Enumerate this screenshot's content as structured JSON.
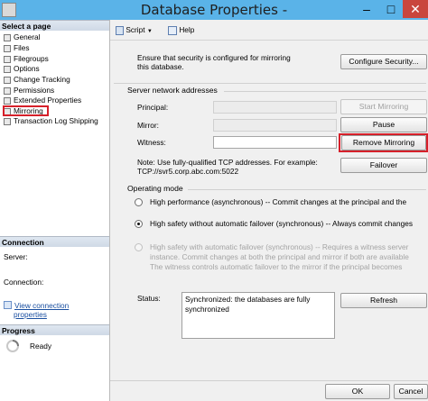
{
  "window": {
    "title": "Database Properties -",
    "minimize": "–",
    "maximize": "□",
    "close": "✕"
  },
  "left": {
    "select_page_header": "Select a page",
    "pages": [
      "General",
      "Files",
      "Filegroups",
      "Options",
      "Change Tracking",
      "Permissions",
      "Extended Properties",
      "Mirroring",
      "Transaction Log Shipping"
    ],
    "connection_header": "Connection",
    "server_label": "Server:",
    "connection_label": "Connection:",
    "view_link_line1": "View connection",
    "view_link_line2": "properties",
    "progress_header": "Progress",
    "progress_status": "Ready"
  },
  "toolbar": {
    "script_label": "Script",
    "help_label": "Help"
  },
  "mirroring": {
    "security_text_line1": "Ensure that security is configured for mirroring",
    "security_text_line2": "this database.",
    "configure_security_button": "Configure Security...",
    "network_group_label": "Server network addresses",
    "principal_label": "Principal:",
    "mirror_label": "Mirror:",
    "witness_label": "Witness:",
    "start_mirroring_button": "Start Mirroring",
    "pause_button": "Pause",
    "remove_mirroring_button": "Remove Mirroring",
    "note_line1": "Note: Use fully-qualified TCP addresses. For example:",
    "note_line2": "TCP://svr5.corp.abc.com:5022",
    "failover_button": "Failover",
    "operating_mode_label": "Operating mode",
    "mode_high_performance": "High performance (asynchronous) -- Commit changes at the principal and the",
    "mode_high_safety_no_failover": "High safety without automatic failover (synchronous) -- Always commit changes",
    "mode_high_safety_failover_line1": "High safety with automatic failover (synchronous) -- Requires a witness server",
    "mode_high_safety_failover_line2": "instance. Commit changes at both the principal and mirror if both are available",
    "mode_high_safety_failover_line3": "The witness controls automatic failover to the mirror if the principal becomes",
    "status_label": "Status:",
    "status_text_line1": "Synchronized: the databases are fully",
    "status_text_line2": "synchronized",
    "refresh_button": "Refresh",
    "ok_button": "OK",
    "cancel_button": "Cancel"
  },
  "colors": {
    "titlebar": "#5ab3e8",
    "highlight": "#d6202a",
    "link": "#1a4fa0"
  }
}
